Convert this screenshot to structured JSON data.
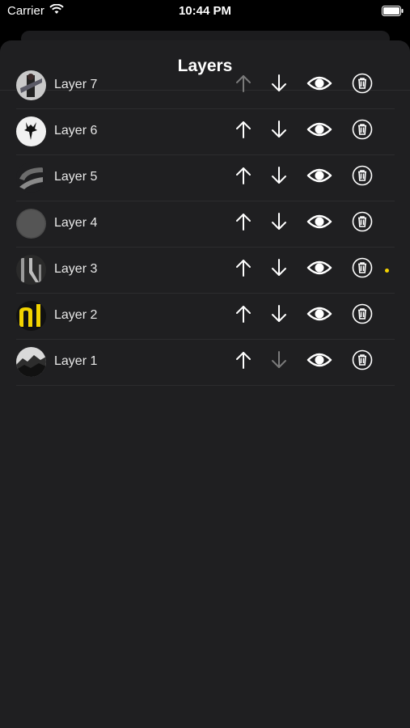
{
  "status_bar": {
    "carrier": "Carrier",
    "time": "10:44 PM"
  },
  "sheet": {
    "title": "Layers"
  },
  "layers": [
    {
      "name": "Layer 7",
      "up_enabled": false,
      "down_enabled": true,
      "active": false
    },
    {
      "name": "Layer 6",
      "up_enabled": true,
      "down_enabled": true,
      "active": false
    },
    {
      "name": "Layer 5",
      "up_enabled": true,
      "down_enabled": true,
      "active": false
    },
    {
      "name": "Layer 4",
      "up_enabled": true,
      "down_enabled": true,
      "active": false
    },
    {
      "name": "Layer 3",
      "up_enabled": true,
      "down_enabled": true,
      "active": true
    },
    {
      "name": "Layer 2",
      "up_enabled": true,
      "down_enabled": true,
      "active": false
    },
    {
      "name": "Layer 1",
      "up_enabled": true,
      "down_enabled": false,
      "active": false
    }
  ],
  "colors": {
    "background": "#1f1f21",
    "accent": "#f4d200",
    "icon": "#ffffff",
    "disabled_icon": "#7a7a7a"
  },
  "icons": [
    "arrow-up-icon",
    "arrow-down-icon",
    "eye-icon",
    "trash-icon"
  ]
}
